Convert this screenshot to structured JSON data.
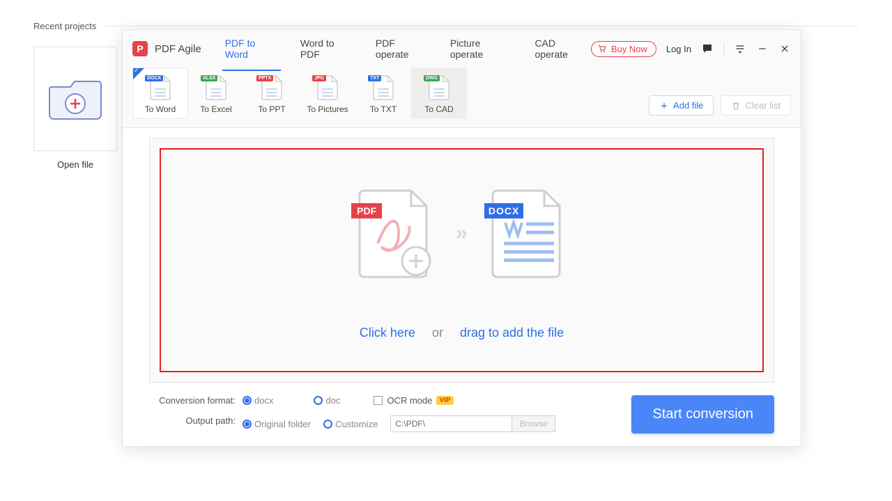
{
  "recent": {
    "heading": "Recent projects",
    "open_label": "Open file"
  },
  "app": {
    "name": "PDF Agile",
    "buy_label": "Buy Now",
    "login_label": "Log In"
  },
  "main_tabs": [
    {
      "label": "PDF to Word",
      "active": true
    },
    {
      "label": "Word to PDF",
      "active": false
    },
    {
      "label": "PDF operate",
      "active": false
    },
    {
      "label": "Picture operate",
      "active": false
    },
    {
      "label": "CAD operate",
      "active": false
    }
  ],
  "format_buttons": [
    {
      "label": "To Word",
      "badge": "DOCX",
      "badge_color": "#2f6fe6",
      "state": "active"
    },
    {
      "label": "To Excel",
      "badge": "XLSX",
      "badge_color": "#3aa757",
      "state": ""
    },
    {
      "label": "To PPT",
      "badge": "PPTX",
      "badge_color": "#e6424a",
      "state": ""
    },
    {
      "label": "To Pictures",
      "badge": "JPG",
      "badge_color": "#e6424a",
      "state": ""
    },
    {
      "label": "To TXT",
      "badge": "TXT",
      "badge_color": "#2f6fe6",
      "state": ""
    },
    {
      "label": "To CAD",
      "badge": "DWG",
      "badge_color": "#3aa757",
      "state": "hover"
    }
  ],
  "toolbar": {
    "add_file": "Add file",
    "clear_list": "Clear list"
  },
  "drop": {
    "pdf_badge": "PDF",
    "docx_badge": "DOCX",
    "click_here": "Click here",
    "or": "or",
    "drag_text": "drag to add the file"
  },
  "options": {
    "conversion_format_label": "Conversion format:",
    "docx": "docx",
    "doc": "doc",
    "ocr_mode": "OCR mode",
    "vip": "VIP",
    "output_path_label": "Output path:",
    "original_folder": "Original folder",
    "customize": "Customize",
    "path_value": "C:\\PDF\\",
    "browse": "Browse"
  },
  "start_label": "Start conversion"
}
